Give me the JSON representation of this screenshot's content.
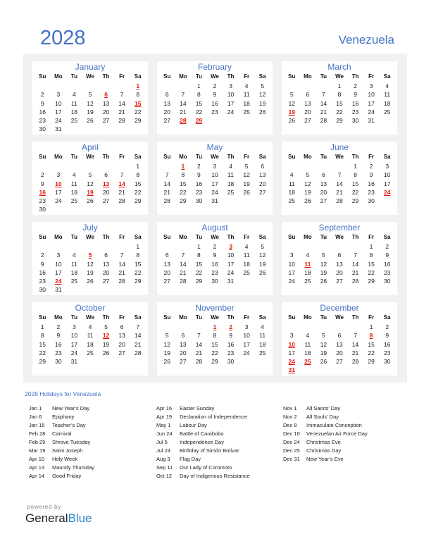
{
  "header": {
    "year": "2028",
    "country": "Venezuela"
  },
  "weekdays": [
    "Su",
    "Mo",
    "Tu",
    "We",
    "Th",
    "Fr",
    "Sa"
  ],
  "months": [
    {
      "name": "January",
      "start": 6,
      "days": 31,
      "holidays": [
        1,
        6,
        15
      ]
    },
    {
      "name": "February",
      "start": 2,
      "days": 29,
      "holidays": [
        28,
        29
      ]
    },
    {
      "name": "March",
      "start": 3,
      "days": 31,
      "holidays": [
        19
      ]
    },
    {
      "name": "April",
      "start": 6,
      "days": 30,
      "holidays": [
        10,
        13,
        14,
        16,
        19
      ]
    },
    {
      "name": "May",
      "start": 1,
      "days": 31,
      "holidays": [
        1
      ]
    },
    {
      "name": "June",
      "start": 4,
      "days": 30,
      "holidays": [
        24
      ]
    },
    {
      "name": "July",
      "start": 6,
      "days": 31,
      "holidays": [
        5,
        24
      ]
    },
    {
      "name": "August",
      "start": 2,
      "days": 31,
      "holidays": [
        3
      ]
    },
    {
      "name": "September",
      "start": 5,
      "days": 30,
      "holidays": [
        11
      ]
    },
    {
      "name": "October",
      "start": 0,
      "days": 31,
      "holidays": [
        12
      ]
    },
    {
      "name": "November",
      "start": 3,
      "days": 30,
      "holidays": [
        1,
        2
      ]
    },
    {
      "name": "December",
      "start": 5,
      "days": 31,
      "holidays": [
        8,
        10,
        24,
        25,
        31
      ]
    }
  ],
  "holidays_title": "2028 Holidays for Venezuela",
  "holiday_columns": [
    [
      {
        "date": "Jan 1",
        "name": "New Year’s Day"
      },
      {
        "date": "Jan 6",
        "name": "Epiphany"
      },
      {
        "date": "Jan 15",
        "name": "Teacher’s Day"
      },
      {
        "date": "Feb 28",
        "name": "Carnival"
      },
      {
        "date": "Feb 29",
        "name": "Shrove Tuesday"
      },
      {
        "date": "Mar 19",
        "name": "Saint Joseph"
      },
      {
        "date": "Apr 10",
        "name": "Holy Week"
      },
      {
        "date": "Apr 13",
        "name": "Maundy Thursday"
      },
      {
        "date": "Apr 14",
        "name": "Good Friday"
      }
    ],
    [
      {
        "date": "Apr 16",
        "name": "Easter Sunday"
      },
      {
        "date": "Apr 19",
        "name": "Declaration of Independence"
      },
      {
        "date": "May 1",
        "name": "Labour Day"
      },
      {
        "date": "Jun 24",
        "name": "Battle of Carabobo"
      },
      {
        "date": "Jul 5",
        "name": "Independence Day"
      },
      {
        "date": "Jul 24",
        "name": "Birthday of Simón Bolívar"
      },
      {
        "date": "Aug 3",
        "name": "Flag Day"
      },
      {
        "date": "Sep 11",
        "name": "Our Lady of Coromoto"
      },
      {
        "date": "Oct 12",
        "name": "Day of Indigenous Resistance"
      }
    ],
    [
      {
        "date": "Nov 1",
        "name": "All Saints’ Day"
      },
      {
        "date": "Nov 2",
        "name": "All Souls’ Day"
      },
      {
        "date": "Dec 8",
        "name": "Immaculate Conception"
      },
      {
        "date": "Dec 10",
        "name": "Venezuelan Air Force Day"
      },
      {
        "date": "Dec 24",
        "name": "Christmas Eve"
      },
      {
        "date": "Dec 25",
        "name": "Christmas Day"
      },
      {
        "date": "Dec 31",
        "name": "New Year’s Eve"
      }
    ]
  ],
  "footer": {
    "powered_by": "powered by",
    "brand_general": "General",
    "brand_blue": "Blue"
  },
  "colors": {
    "accent": "#4472c4",
    "holiday": "#e3170a",
    "panel": "#f1f1f1",
    "brand_blue": "#2e86c9"
  }
}
